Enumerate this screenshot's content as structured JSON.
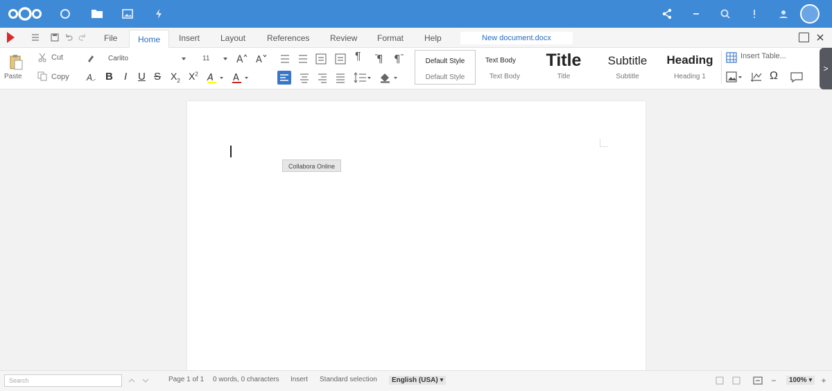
{
  "header": {
    "logo": "nextcloud-logo",
    "apps": [
      "dashboard-icon",
      "files-icon",
      "photos-icon",
      "activity-icon"
    ],
    "right_icons": [
      "share-icon",
      "minus-icon",
      "search-icon",
      "notifications-icon",
      "contacts-icon"
    ]
  },
  "menubar": {
    "tabs": [
      "File",
      "Home",
      "Insert",
      "Layout",
      "References",
      "Review",
      "Format",
      "Help"
    ],
    "active_tab": "Home",
    "document_name": "New document.docx"
  },
  "ribbon": {
    "paste_label": "Paste",
    "cut_label": "Cut",
    "copy_label": "Copy",
    "font_name": "Carlito",
    "font_size": "11",
    "styles": {
      "default_top": "Default Style",
      "default_bottom": "Default Style",
      "text_body_top": "Text Body",
      "text_body_bottom": "Text Body",
      "title_big": "Title",
      "title_small": "Title",
      "subtitle_big": "Subtitle",
      "subtitle_small": "Subtitle",
      "heading_big": "Heading",
      "heading_small": "Heading 1"
    },
    "insert_table_label": "Insert Table..."
  },
  "document": {
    "tooltip": "Collabora Online"
  },
  "statusbar": {
    "search_placeholder": "Search",
    "page_info": "Page 1 of 1",
    "word_info": "0 words, 0 characters",
    "insert_mode": "Insert",
    "selection_mode": "Standard selection",
    "language": "English (USA)",
    "zoom": "100%"
  },
  "colors": {
    "header_bg": "#3f8ad6",
    "accent": "#2a6bc0"
  }
}
